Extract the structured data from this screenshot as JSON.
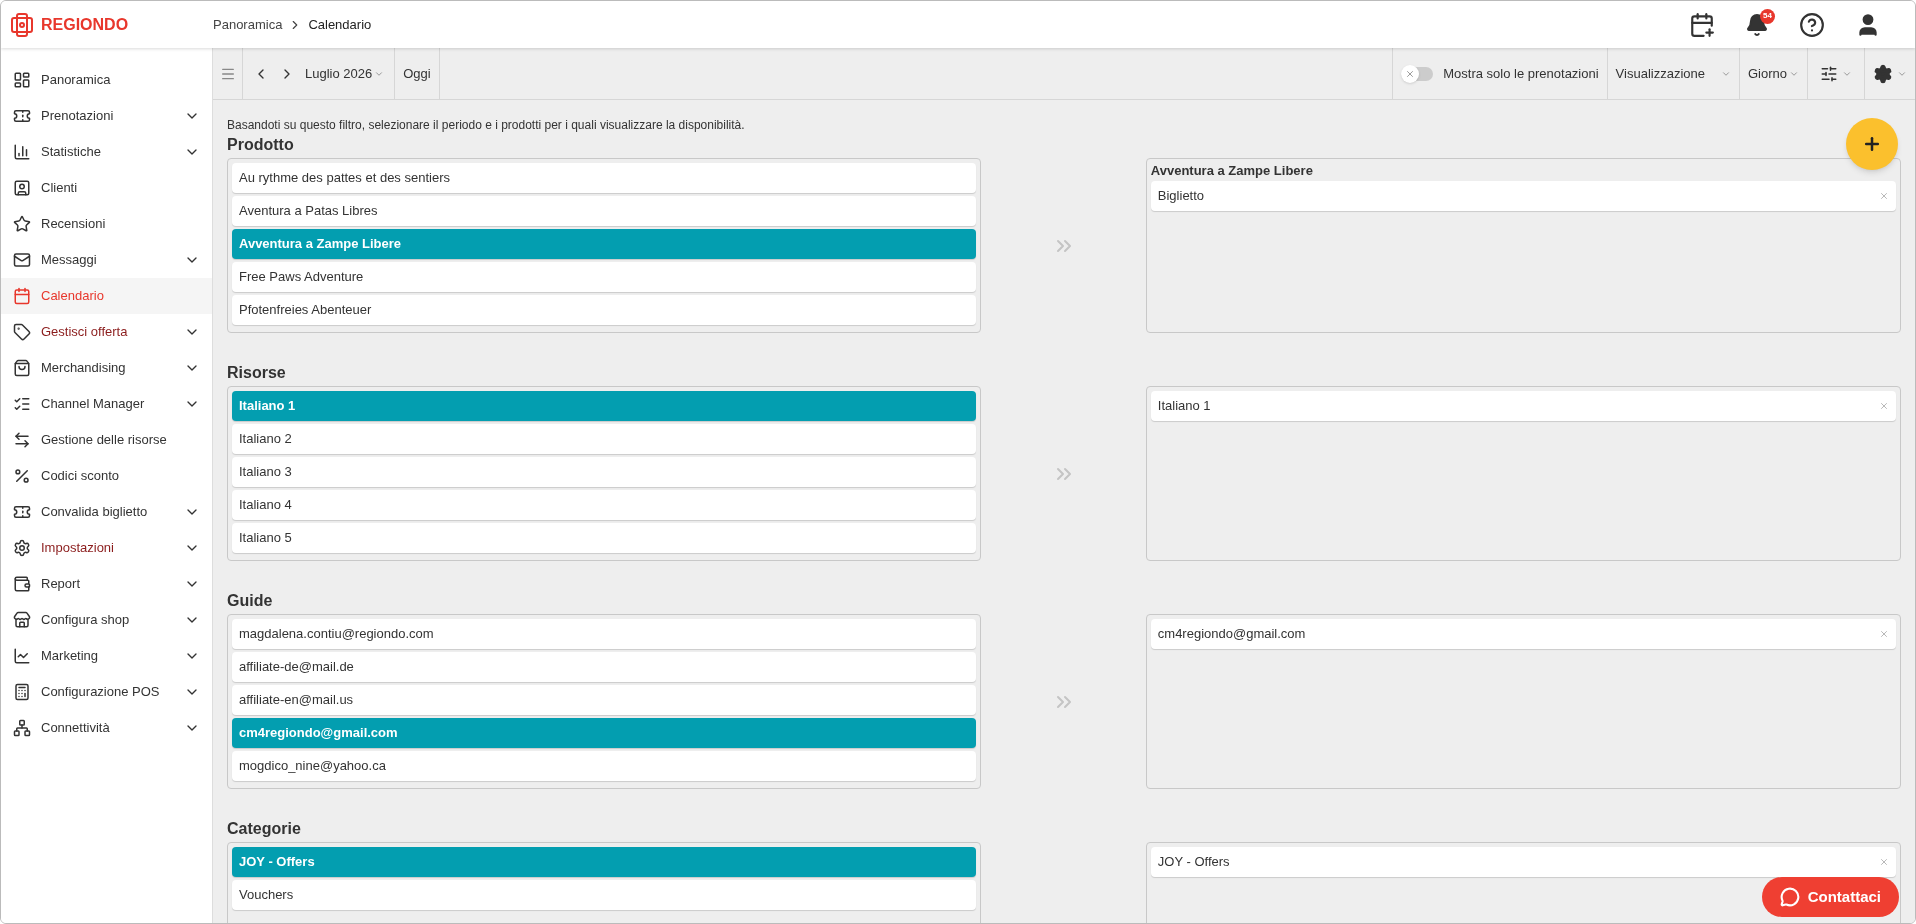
{
  "header": {
    "logo": "REGIONDO",
    "breadcrumb": [
      "Panoramica",
      "Calendario"
    ],
    "notifications": "54"
  },
  "sidebar": {
    "items": [
      {
        "label": "Panoramica",
        "expandable": false,
        "selected": false,
        "highlighted": false
      },
      {
        "label": "Prenotazioni",
        "expandable": true,
        "selected": false,
        "highlighted": false
      },
      {
        "label": "Statistiche",
        "expandable": true,
        "selected": false,
        "highlighted": false
      },
      {
        "label": "Clienti",
        "expandable": false,
        "selected": false,
        "highlighted": false
      },
      {
        "label": "Recensioni",
        "expandable": false,
        "selected": false,
        "highlighted": false
      },
      {
        "label": "Messaggi",
        "expandable": true,
        "selected": false,
        "highlighted": false
      },
      {
        "label": "Calendario",
        "expandable": false,
        "selected": true,
        "highlighted": false
      },
      {
        "label": "Gestisci offerta",
        "expandable": true,
        "selected": false,
        "highlighted": true
      },
      {
        "label": "Merchandising",
        "expandable": true,
        "selected": false,
        "highlighted": false
      },
      {
        "label": "Channel Manager",
        "expandable": true,
        "selected": false,
        "highlighted": false
      },
      {
        "label": "Gestione delle risorse",
        "expandable": false,
        "selected": false,
        "highlighted": false
      },
      {
        "label": "Codici sconto",
        "expandable": false,
        "selected": false,
        "highlighted": false
      },
      {
        "label": "Convalida biglietto",
        "expandable": true,
        "selected": false,
        "highlighted": false
      },
      {
        "label": "Impostazioni",
        "expandable": true,
        "selected": false,
        "highlighted": true
      },
      {
        "label": "Report",
        "expandable": true,
        "selected": false,
        "highlighted": false
      },
      {
        "label": "Configura shop",
        "expandable": true,
        "selected": false,
        "highlighted": false
      },
      {
        "label": "Marketing",
        "expandable": true,
        "selected": false,
        "highlighted": false
      },
      {
        "label": "Configurazione POS",
        "expandable": true,
        "selected": false,
        "highlighted": false
      },
      {
        "label": "Connettività",
        "expandable": true,
        "selected": false,
        "highlighted": false
      }
    ]
  },
  "toolbar": {
    "month": "Luglio 2026",
    "today": "Oggi",
    "toggle": {
      "label": "Mostra solo le prenotazioni",
      "on": false
    },
    "view": "Visualizzazione",
    "period": "Giorno"
  },
  "intro": "Basandoti su questo filtro, selezionare il periodo e i prodotti per i quali visualizzare la disponibilità.",
  "sections": [
    {
      "title": "Prodotto",
      "options": [
        {
          "label": "Au rythme des pattes et des sentiers",
          "selected": false
        },
        {
          "label": "Aventura a Patas Libres",
          "selected": false
        },
        {
          "label": "Avventura a Zampe Libere",
          "selected": true
        },
        {
          "label": "Free Paws Adventure",
          "selected": false
        },
        {
          "label": "Pfotenfreies Abenteuer",
          "selected": false
        }
      ],
      "chosen": {
        "heading": "Avventura a Zampe Libere",
        "items": [
          "Biglietto"
        ]
      }
    },
    {
      "title": "Risorse",
      "options": [
        {
          "label": "Italiano 1",
          "selected": true
        },
        {
          "label": "Italiano 2",
          "selected": false
        },
        {
          "label": "Italiano 3",
          "selected": false
        },
        {
          "label": "Italiano 4",
          "selected": false
        },
        {
          "label": "Italiano 5",
          "selected": false
        }
      ],
      "chosen": {
        "items": [
          "Italiano 1"
        ]
      }
    },
    {
      "title": "Guide",
      "options": [
        {
          "label": "magdalena.contiu@regiondo.com",
          "selected": false
        },
        {
          "label": "affiliate-de@mail.de",
          "selected": false
        },
        {
          "label": "affiliate-en@mail.us",
          "selected": false
        },
        {
          "label": "cm4regiondo@gmail.com",
          "selected": true
        },
        {
          "label": "mogdico_nine@yahoo.ca",
          "selected": false
        }
      ],
      "chosen": {
        "items": [
          "cm4regiondo@gmail.com"
        ]
      }
    },
    {
      "title": "Categorie",
      "options": [
        {
          "label": "JOY - Offers",
          "selected": true
        },
        {
          "label": "Vouchers",
          "selected": false
        }
      ],
      "chosen": {
        "items": [
          "JOY - Offers"
        ]
      }
    }
  ],
  "contact": "Contattaci"
}
